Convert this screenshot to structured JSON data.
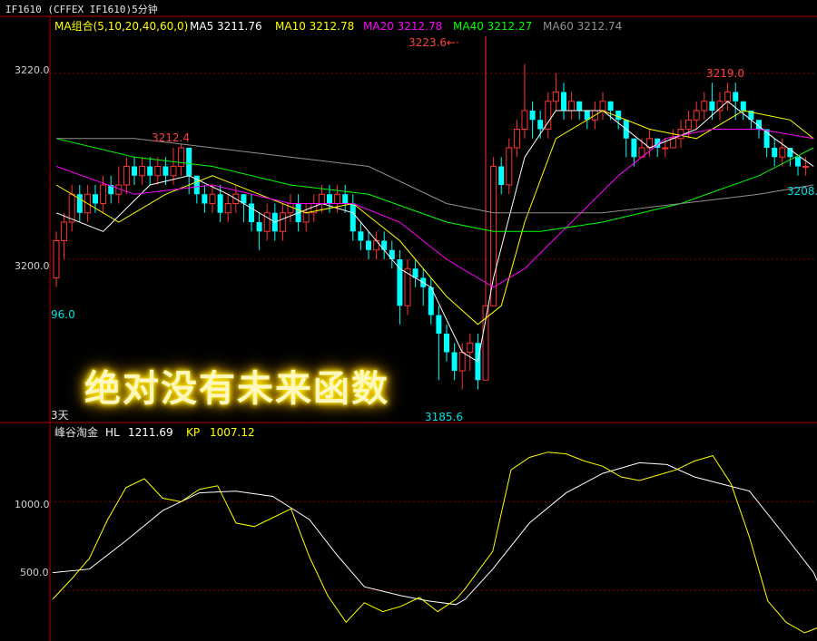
{
  "title": "IF1610  (CFFEX IF1610)5分钟",
  "ma_legend": {
    "group": "MA组合(5,10,20,40,60,0)",
    "items": [
      {
        "label": "MA5 3211.76",
        "color": "#ffffff"
      },
      {
        "label": "MA10 3212.78",
        "color": "#ffff00"
      },
      {
        "label": "MA20 3212.78",
        "color": "#ff00ff"
      },
      {
        "label": "MA40 3212.27",
        "color": "#00ff00"
      },
      {
        "label": "MA60 3212.74",
        "color": "#909090"
      }
    ]
  },
  "price_axis": [
    "3220.0",
    "3200.0"
  ],
  "annotations": {
    "high_line": "3223.6",
    "left_high": "3212.4",
    "right_high": "3219.0",
    "low": "3185.6",
    "right_clip": "3208.",
    "left_low_clip": "96.0",
    "left_day_clip": "3天"
  },
  "banner": "绝对没有未来函数",
  "indicator": {
    "name": "峰谷淘金",
    "hl_label": "HL",
    "hl_value": "1211.69",
    "kp_label": "KP",
    "kp_value": "1007.12",
    "axis": [
      "1000.0",
      "500.0"
    ]
  },
  "colors": {
    "up": "#ff3030",
    "down": "#00ffff",
    "frame": "#b00000",
    "grid": "#8b0000"
  },
  "chart_data": {
    "type": "candlestick",
    "price_ylim": [
      3184,
      3224
    ],
    "candles": [
      [
        3198,
        3202,
        3203,
        3197
      ],
      [
        3202,
        3204,
        3205,
        3200
      ],
      [
        3204,
        3207,
        3208,
        3203
      ],
      [
        3207,
        3205,
        3208,
        3204
      ],
      [
        3205,
        3207,
        3208,
        3204
      ],
      [
        3207,
        3206,
        3208,
        3205
      ],
      [
        3206,
        3208,
        3209,
        3205
      ],
      [
        3208,
        3207,
        3209,
        3206
      ],
      [
        3207,
        3208,
        3210,
        3206
      ],
      [
        3208,
        3210,
        3211,
        3207
      ],
      [
        3210,
        3209,
        3211,
        3208
      ],
      [
        3209,
        3210,
        3211,
        3208
      ],
      [
        3210,
        3209,
        3211,
        3208
      ],
      [
        3209,
        3210,
        3211,
        3208
      ],
      [
        3210,
        3209,
        3211,
        3208
      ],
      [
        3209,
        3210,
        3212,
        3208
      ],
      [
        3210,
        3212,
        3212.4,
        3209
      ],
      [
        3212,
        3209,
        3212,
        3207
      ],
      [
        3209,
        3207,
        3209,
        3206
      ],
      [
        3207,
        3206,
        3208,
        3205
      ],
      [
        3206,
        3207,
        3208,
        3205
      ],
      [
        3207,
        3205,
        3208,
        3204
      ],
      [
        3205,
        3206,
        3207,
        3204
      ],
      [
        3206,
        3207,
        3208,
        3205
      ],
      [
        3207,
        3206,
        3207,
        3204
      ],
      [
        3206,
        3204,
        3207,
        3203
      ],
      [
        3204,
        3203,
        3205,
        3201
      ],
      [
        3203,
        3205,
        3206,
        3202
      ],
      [
        3205,
        3203,
        3206,
        3202
      ],
      [
        3203,
        3205,
        3206,
        3202
      ],
      [
        3205,
        3206,
        3207,
        3204
      ],
      [
        3206,
        3204,
        3207,
        3203
      ],
      [
        3204,
        3205,
        3206,
        3203
      ],
      [
        3205,
        3206,
        3207,
        3204
      ],
      [
        3206,
        3207,
        3208,
        3205
      ],
      [
        3207,
        3206,
        3208,
        3205
      ],
      [
        3206,
        3207,
        3208,
        3205
      ],
      [
        3207,
        3206,
        3208,
        3205
      ],
      [
        3206,
        3203,
        3207,
        3202
      ],
      [
        3203,
        3202,
        3204,
        3201
      ],
      [
        3202,
        3201,
        3203,
        3200
      ],
      [
        3201,
        3202,
        3203,
        3200
      ],
      [
        3202,
        3201,
        3203,
        3200
      ],
      [
        3201,
        3200,
        3202,
        3199
      ],
      [
        3200,
        3195,
        3201,
        3193
      ],
      [
        3195,
        3199,
        3200,
        3194
      ],
      [
        3199,
        3198,
        3200,
        3197
      ],
      [
        3198,
        3197,
        3199,
        3195
      ],
      [
        3197,
        3194,
        3198,
        3193
      ],
      [
        3194,
        3192,
        3195,
        3187
      ],
      [
        3192,
        3190,
        3193,
        3189
      ],
      [
        3190,
        3188,
        3191,
        3187
      ],
      [
        3188,
        3190,
        3191,
        3186
      ],
      [
        3190,
        3191,
        3192,
        3188
      ],
      [
        3191,
        3187,
        3192,
        3186
      ],
      [
        3187,
        3195,
        3223.6,
        3187
      ],
      [
        3195,
        3210,
        3211,
        3195
      ],
      [
        3210,
        3208,
        3211,
        3207
      ],
      [
        3208,
        3212,
        3213,
        3207
      ],
      [
        3212,
        3214,
        3215,
        3211
      ],
      [
        3214,
        3216,
        3221,
        3213
      ],
      [
        3216,
        3215,
        3217,
        3213
      ],
      [
        3215,
        3214,
        3216,
        3213
      ],
      [
        3214,
        3217,
        3218,
        3213
      ],
      [
        3217,
        3218,
        3220,
        3216
      ],
      [
        3218,
        3216,
        3219,
        3215
      ],
      [
        3216,
        3217,
        3218,
        3215
      ],
      [
        3217,
        3216,
        3217,
        3215
      ],
      [
        3216,
        3215,
        3216,
        3214
      ],
      [
        3215,
        3216,
        3217,
        3214
      ],
      [
        3216,
        3217,
        3218,
        3215
      ],
      [
        3217,
        3216,
        3217,
        3215
      ],
      [
        3216,
        3215,
        3216,
        3214
      ],
      [
        3215,
        3213,
        3215,
        3211
      ],
      [
        3213,
        3211,
        3213,
        3210
      ],
      [
        3211,
        3212,
        3213,
        3211
      ],
      [
        3212,
        3213,
        3214,
        3211
      ],
      [
        3213,
        3212,
        3213,
        3211
      ],
      [
        3212,
        3212,
        3213,
        3211
      ],
      [
        3212,
        3213,
        3214,
        3212
      ],
      [
        3213,
        3214,
        3215,
        3212
      ],
      [
        3214,
        3215,
        3216,
        3213
      ],
      [
        3215,
        3216,
        3217,
        3214
      ],
      [
        3216,
        3217,
        3218,
        3215
      ],
      [
        3217,
        3216,
        3219,
        3215
      ],
      [
        3216,
        3217,
        3218,
        3215
      ],
      [
        3217,
        3218,
        3219,
        3216
      ],
      [
        3218,
        3217,
        3219,
        3215
      ],
      [
        3217,
        3216,
        3217,
        3215
      ],
      [
        3216,
        3215,
        3216,
        3214
      ],
      [
        3215,
        3214,
        3215,
        3213
      ],
      [
        3214,
        3212,
        3214,
        3211
      ],
      [
        3212,
        3211,
        3213,
        3210
      ],
      [
        3211,
        3212,
        3213,
        3210
      ],
      [
        3212,
        3211,
        3212,
        3210
      ],
      [
        3211,
        3210,
        3211,
        3209
      ],
      [
        3210,
        3210,
        3211,
        3209
      ]
    ],
    "ma_series": [
      {
        "name": "MA5",
        "color": "#ffffff",
        "points": [
          [
            0,
            3205
          ],
          [
            6,
            3203
          ],
          [
            12,
            3208
          ],
          [
            17,
            3209
          ],
          [
            22,
            3207
          ],
          [
            28,
            3204
          ],
          [
            34,
            3206
          ],
          [
            38,
            3205
          ],
          [
            44,
            3199
          ],
          [
            48,
            3197
          ],
          [
            52,
            3190
          ],
          [
            54,
            3189
          ],
          [
            56,
            3198
          ],
          [
            60,
            3211
          ],
          [
            64,
            3216
          ],
          [
            70,
            3216
          ],
          [
            76,
            3212
          ],
          [
            82,
            3214
          ],
          [
            86,
            3217
          ],
          [
            92,
            3213
          ],
          [
            97,
            3210
          ]
        ]
      },
      {
        "name": "MA10",
        "color": "#ffff00",
        "points": [
          [
            0,
            3208
          ],
          [
            8,
            3204
          ],
          [
            14,
            3207
          ],
          [
            20,
            3209
          ],
          [
            26,
            3207
          ],
          [
            32,
            3205
          ],
          [
            38,
            3206
          ],
          [
            44,
            3202
          ],
          [
            50,
            3196
          ],
          [
            54,
            3193
          ],
          [
            57,
            3195
          ],
          [
            60,
            3204
          ],
          [
            64,
            3213
          ],
          [
            70,
            3216
          ],
          [
            76,
            3214
          ],
          [
            82,
            3213
          ],
          [
            88,
            3216
          ],
          [
            94,
            3215
          ],
          [
            97,
            3213
          ]
        ]
      },
      {
        "name": "MA20",
        "color": "#ff00ff",
        "points": [
          [
            0,
            3210
          ],
          [
            10,
            3207
          ],
          [
            20,
            3208
          ],
          [
            30,
            3206
          ],
          [
            38,
            3206
          ],
          [
            44,
            3204
          ],
          [
            50,
            3200
          ],
          [
            56,
            3197
          ],
          [
            60,
            3199
          ],
          [
            66,
            3204
          ],
          [
            72,
            3209
          ],
          [
            78,
            3213
          ],
          [
            84,
            3214
          ],
          [
            90,
            3214
          ],
          [
            97,
            3213
          ]
        ]
      },
      {
        "name": "MA40",
        "color": "#00ff00",
        "points": [
          [
            0,
            3213
          ],
          [
            10,
            3211
          ],
          [
            20,
            3210
          ],
          [
            30,
            3208
          ],
          [
            40,
            3207
          ],
          [
            50,
            3204
          ],
          [
            56,
            3203
          ],
          [
            62,
            3203
          ],
          [
            70,
            3204
          ],
          [
            80,
            3206
          ],
          [
            90,
            3209
          ],
          [
            97,
            3212
          ]
        ]
      },
      {
        "name": "MA60",
        "color": "#909090",
        "points": [
          [
            0,
            3213
          ],
          [
            10,
            3213
          ],
          [
            20,
            3212
          ],
          [
            30,
            3211
          ],
          [
            40,
            3210
          ],
          [
            50,
            3206
          ],
          [
            56,
            3205
          ],
          [
            62,
            3205
          ],
          [
            70,
            3205
          ],
          [
            80,
            3206
          ],
          [
            90,
            3207
          ],
          [
            97,
            3208
          ]
        ]
      }
    ],
    "indicator_ylim": [
      250,
      1350
    ],
    "indicator_series": [
      {
        "name": "HL",
        "color": "#ffffff",
        "points": [
          [
            0,
            600
          ],
          [
            8,
            620
          ],
          [
            16,
            780
          ],
          [
            24,
            950
          ],
          [
            32,
            1050
          ],
          [
            40,
            1060
          ],
          [
            48,
            1030
          ],
          [
            56,
            900
          ],
          [
            62,
            700
          ],
          [
            68,
            520
          ],
          [
            76,
            470
          ],
          [
            82,
            440
          ],
          [
            88,
            420
          ],
          [
            90,
            450
          ],
          [
            96,
            620
          ],
          [
            104,
            880
          ],
          [
            112,
            1050
          ],
          [
            120,
            1160
          ],
          [
            128,
            1220
          ],
          [
            134,
            1210
          ],
          [
            140,
            1140
          ],
          [
            146,
            1100
          ],
          [
            152,
            1060
          ],
          [
            160,
            800
          ],
          [
            166,
            600
          ],
          [
            168,
            480
          ]
        ]
      },
      {
        "name": "KP",
        "color": "#ffff00",
        "points": [
          [
            0,
            450
          ],
          [
            4,
            560
          ],
          [
            8,
            680
          ],
          [
            12,
            900
          ],
          [
            16,
            1080
          ],
          [
            20,
            1130
          ],
          [
            24,
            1020
          ],
          [
            28,
            1000
          ],
          [
            32,
            1070
          ],
          [
            36,
            1090
          ],
          [
            40,
            880
          ],
          [
            44,
            860
          ],
          [
            48,
            910
          ],
          [
            52,
            960
          ],
          [
            56,
            690
          ],
          [
            60,
            470
          ],
          [
            64,
            320
          ],
          [
            68,
            430
          ],
          [
            72,
            380
          ],
          [
            76,
            410
          ],
          [
            80,
            460
          ],
          [
            84,
            380
          ],
          [
            88,
            450
          ],
          [
            90,
            510
          ],
          [
            96,
            720
          ],
          [
            100,
            1180
          ],
          [
            104,
            1250
          ],
          [
            108,
            1280
          ],
          [
            112,
            1270
          ],
          [
            116,
            1230
          ],
          [
            120,
            1200
          ],
          [
            124,
            1140
          ],
          [
            128,
            1120
          ],
          [
            132,
            1150
          ],
          [
            136,
            1180
          ],
          [
            140,
            1230
          ],
          [
            144,
            1260
          ],
          [
            148,
            1100
          ],
          [
            152,
            800
          ],
          [
            156,
            440
          ],
          [
            160,
            320
          ],
          [
            164,
            260
          ],
          [
            168,
            300
          ]
        ]
      }
    ]
  }
}
